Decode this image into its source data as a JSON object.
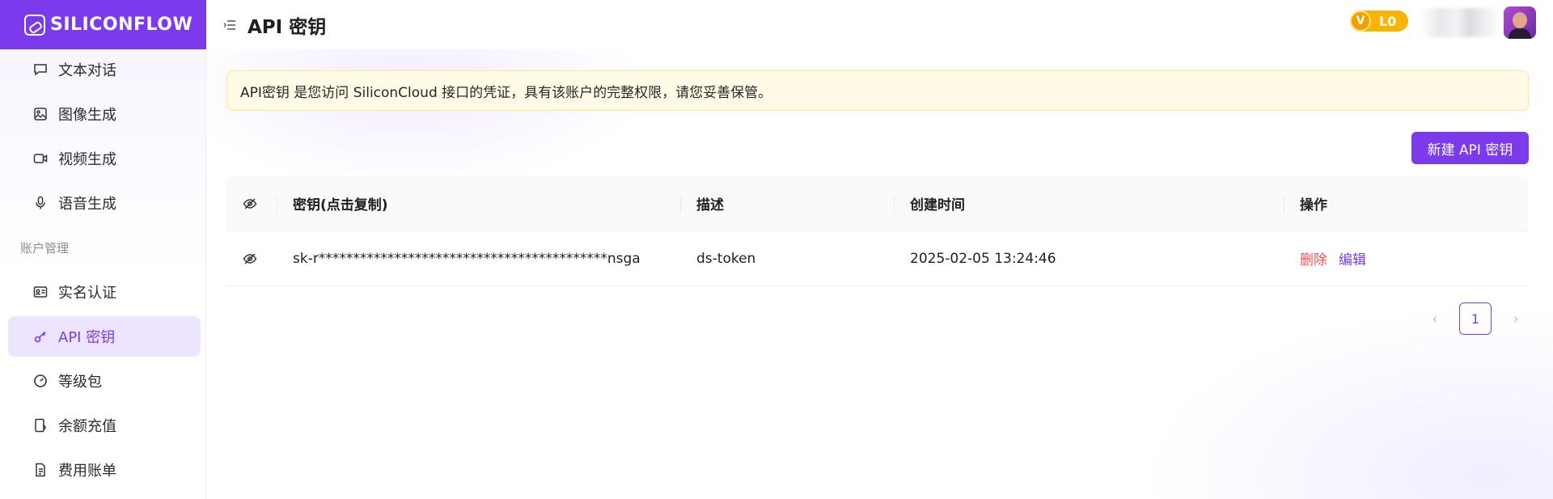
{
  "brand": {
    "name": "SILICONFLOW",
    "color": "#7c3aed"
  },
  "sidebar": {
    "items_top": [
      {
        "label": "文本对话",
        "icon": "chat-icon"
      },
      {
        "label": "图像生成",
        "icon": "image-icon"
      },
      {
        "label": "视频生成",
        "icon": "video-icon"
      },
      {
        "label": "语音生成",
        "icon": "microphone-icon"
      }
    ],
    "group_label": "账户管理",
    "items_account": [
      {
        "label": "实名认证",
        "icon": "id-card-icon"
      },
      {
        "label": "API 密钥",
        "icon": "key-icon",
        "active": true
      },
      {
        "label": "等级包",
        "icon": "gauge-icon"
      },
      {
        "label": "余额充值",
        "icon": "recharge-icon"
      },
      {
        "label": "费用账单",
        "icon": "bill-icon"
      }
    ]
  },
  "header": {
    "title": "API 密钥",
    "level_badge": {
      "icon_letter": "V",
      "label": "L0"
    }
  },
  "main": {
    "notice": "API密钥 是您访问 SiliconCloud 接口的凭证，具有该账户的完整权限，请您妥善保管。",
    "new_key_button": "新建 API 密钥",
    "table": {
      "columns": [
        "密钥(点击复制)",
        "描述",
        "创建时间",
        "操作"
      ],
      "rows": [
        {
          "key": "sk-r******************************************nsga",
          "description": "ds-token",
          "created": "2025-02-05 13:24:46",
          "delete_label": "删除",
          "edit_label": "编辑"
        }
      ]
    },
    "pagination": {
      "current_page": "1",
      "prev": "‹",
      "next": "›"
    }
  }
}
